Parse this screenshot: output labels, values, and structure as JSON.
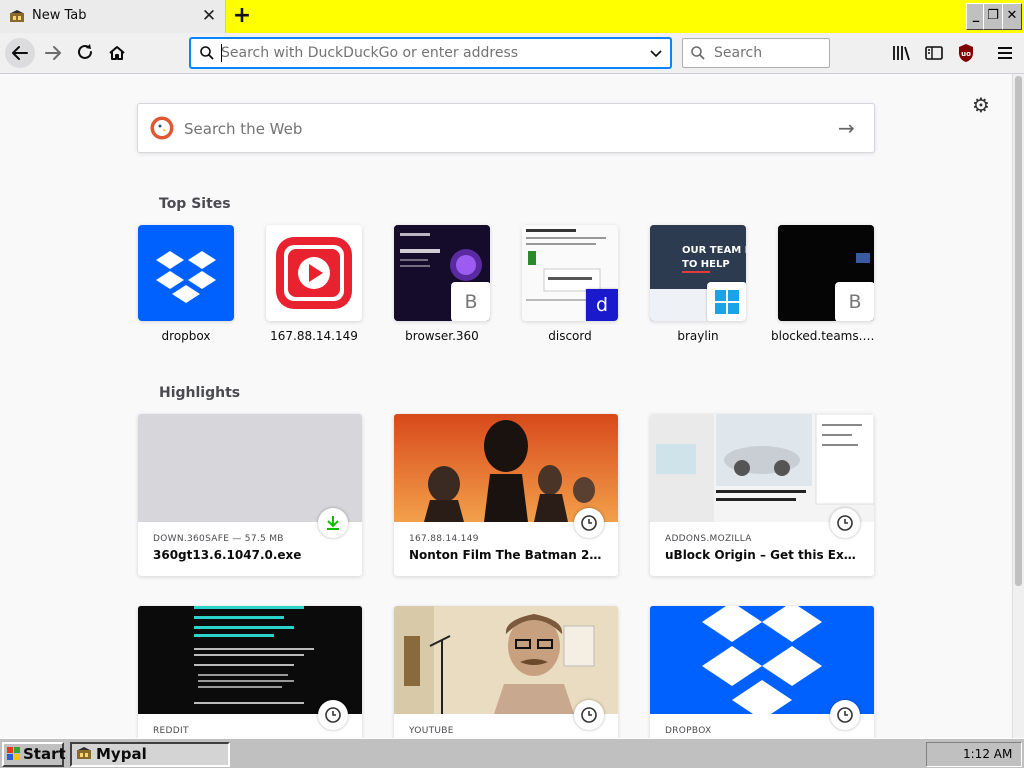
{
  "tab": {
    "title": "New Tab",
    "close_icon": "close-icon",
    "new_tab_symbol": "+"
  },
  "window_controls": {
    "minimize": "_",
    "restore": "❐",
    "close": "✕"
  },
  "navbar": {
    "url_placeholder": "Search with DuckDuckGo or enter address",
    "search_placeholder": "Search",
    "icons": [
      "back-icon",
      "forward-icon",
      "reload-icon",
      "home-icon",
      "library-icon",
      "sidebar-icon",
      "ublock-icon",
      "menu-icon"
    ]
  },
  "newtab": {
    "web_search_placeholder": "Search the Web",
    "top_sites_title": "Top Sites",
    "highlights_title": "Highlights",
    "top_sites": [
      {
        "label": "dropbox"
      },
      {
        "label": "167.88.14.149"
      },
      {
        "label": "browser.360",
        "badge": "B"
      },
      {
        "label": "discord",
        "badge": "d"
      },
      {
        "label": "braylin"
      },
      {
        "label": "blocked.teams.cl...",
        "badge": "B"
      }
    ],
    "highlights": [
      {
        "source": "DOWN.360SAFE — 57.5 MB",
        "title": "360gt13.6.1047.0.exe"
      },
      {
        "source": "167.88.14.149",
        "title": "Nonton Film The Batman 2022 S..."
      },
      {
        "source": "ADDONS.MOZILLA",
        "title": "uBlock Origin – Get this Extensio..."
      },
      {
        "source": "REDDIT",
        "title": ""
      },
      {
        "source": "YOUTUBE",
        "title": ""
      },
      {
        "source": "DROPBOX",
        "title": ""
      }
    ]
  },
  "taskbar": {
    "start_label": "Start",
    "task_label": "Mypal",
    "clock": "1:12 AM"
  },
  "colors": {
    "tabstrip_bg": "#ffff00",
    "dropbox_blue": "#0061fe",
    "accent": "#0a84ff",
    "download_green": "#12bc00"
  }
}
